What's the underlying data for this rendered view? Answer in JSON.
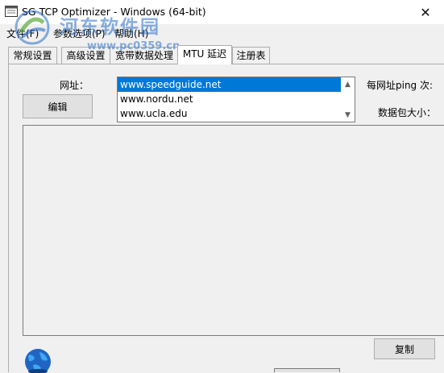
{
  "window": {
    "title": "SG TCP Optimizer - Windows (64-bit)",
    "close_glyph": "✕"
  },
  "menu": {
    "items": [
      {
        "label": "文件(F)"
      },
      {
        "label": "参数选项(P)"
      },
      {
        "label": "帮助(H)"
      }
    ]
  },
  "tabs": [
    {
      "label": "常规设置",
      "active": false
    },
    {
      "label": "高级设置",
      "active": false
    },
    {
      "label": "宽带数据处理",
      "active": false
    },
    {
      "label": "MTU 延迟",
      "active": true
    },
    {
      "label": "注册表",
      "active": false
    }
  ],
  "mtu": {
    "url_label": "网址：",
    "edit_button": "编辑",
    "urls": [
      "www.speedguide.net",
      "www.nordu.net",
      "www.ucla.edu"
    ],
    "selected_url": "www.speedguide.net",
    "pings_label": "每网址ping 次:",
    "packet_size_label": "数据包大小：",
    "copy_button": "复制"
  },
  "watermark": {
    "text": "河东软件园",
    "url": "www.pc0359.cn"
  },
  "icons": {
    "app": "app-window-icon",
    "close": "close-icon",
    "scroll_up": "scroll-up-arrow-icon",
    "scroll_down": "scroll-down-arrow-icon",
    "globe": "globe-icon"
  },
  "colors": {
    "selection": "#0078d7",
    "window_bg": "#f0f0f0",
    "watermark": "#286ec8"
  }
}
